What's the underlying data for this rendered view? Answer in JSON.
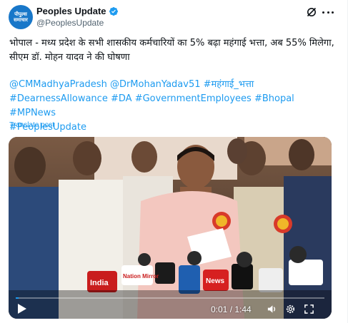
{
  "account": {
    "avatar_line1": "पीपुल्स",
    "avatar_line2": "समाचार",
    "name": "Peoples Update",
    "handle": "@PeoplesUpdate"
  },
  "post": {
    "text": "भोपाल - मध्य प्रदेश के सभी शासकीय कर्मचारियों का 5% बढ़ा महंगाई भत्ता, अब 55% मिलेगा, सीएम डॉ. मोहन यादव ने की घोषणा",
    "tags": [
      "@CMMadhyaPradesh",
      "@DrMohanYadav51",
      "#महंगाई_भत्ता",
      "#DearnessAllowance",
      "#DA",
      "#GovernmentEmployees",
      "#Bhopal",
      "#MPNews",
      "#PeoplesUpdate"
    ],
    "translate_label": "Translate post"
  },
  "video": {
    "time": "0:01 / 1:44",
    "progress": 0.01,
    "mic_labels": [
      "India",
      "Nation Mirror",
      "News"
    ]
  },
  "icons": {
    "verified": "verified-badge-icon",
    "grok": "grok-icon",
    "more": "more-options-icon",
    "play": "play-icon",
    "volume": "volume-icon",
    "settings": "settings-gear-icon",
    "fullscreen": "fullscreen-icon"
  },
  "colors": {
    "link": "#1d9bf0",
    "verified": "#1d9bf0",
    "avatar_bg": "#1877c9",
    "text": "#0f1419",
    "secondary": "#536471"
  }
}
